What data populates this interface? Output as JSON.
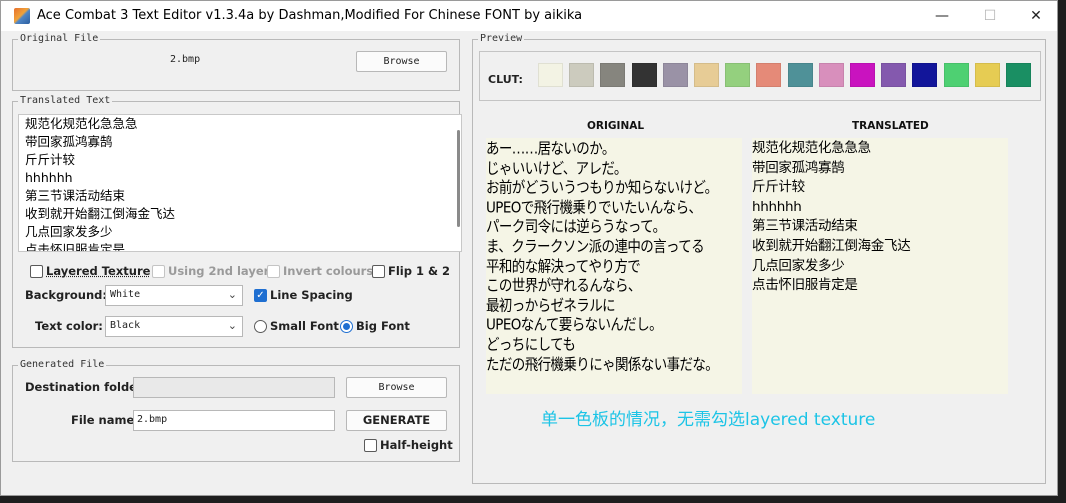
{
  "window": {
    "title": "Ace Combat 3 Text Editor v1.3.4a by Dashman,Modified For Chinese FONT by aikika",
    "minimize": "—",
    "maximize": "☐",
    "close": "✕"
  },
  "original_file": {
    "group_title": "Original File",
    "filename": "2.bmp",
    "browse_label": "Browse"
  },
  "translated_text": {
    "group_title": "Translated Text",
    "lines": [
      "规范化规范化急急急",
      "带回家孤鸿寡鹄",
      "斤斤计较",
      "hhhhhh",
      "第三节课活动结束",
      "收到就开始翻江倒海金飞达",
      "几点回家发多少",
      "点击怀旧服肯定是"
    ]
  },
  "options": {
    "layered_texture": "Layered Texture",
    "using_2nd_layer": "Using 2nd layer",
    "invert_colours": "Invert colours",
    "flip": "Flip 1 & 2",
    "background_label": "Background:",
    "background_value": "White",
    "line_spacing": "Line Spacing",
    "text_color_label": "Text color:",
    "text_color_value": "Black",
    "small_font": "Small Font",
    "big_font": "Big Font"
  },
  "generated_file": {
    "group_title": "Generated File",
    "destination_label": "Destination folder:",
    "destination_value": "",
    "browse_label": "Browse",
    "filename_label": "File name:",
    "filename_value": "2.bmp",
    "generate_label": "GENERATE",
    "half_height": "Half-height"
  },
  "preview": {
    "group_title": "Preview",
    "clut_label": "CLUT:",
    "clut_colors": [
      "#f3f3e4",
      "#cccbbe",
      "#86857e",
      "#333333",
      "#9a92a6",
      "#e7cc96",
      "#94d07e",
      "#e58a78",
      "#4f9198",
      "#d88fbc",
      "#c913bf",
      "#8459ae",
      "#12159a",
      "#4ed072",
      "#e6cc53",
      "#1a8f63"
    ],
    "original_heading": "ORIGINAL",
    "translated_heading": "TRANSLATED",
    "original_lines": [
      "あー……居ないのか。",
      "じゃいいけど、アレだ。",
      "お前がどういうつもりか知らないけど。",
      "UPEOで飛行機乗りでいたいんなら、",
      "パーク司令には逆らうなって。",
      "ま、クラークソン派の連中の言ってる",
      "平和的な解決ってやり方で",
      "この世界が守れるんなら、",
      "最初っからゼネラルに",
      "UPEOなんて要らないんだし。",
      "どっちにしても",
      "ただの飛行機乗りにゃ関係ない事だな。"
    ],
    "translated_lines": [
      "规范化规范化急急急",
      "带回家孤鸿寡鹄",
      "斤斤计较",
      "hhhhhh",
      "第三节课活动结束",
      "收到就开始翻江倒海金飞达",
      "几点回家发多少",
      "点击怀旧服肯定是"
    ]
  },
  "annotation": "单一色板的情况，无需勾选layered texture"
}
